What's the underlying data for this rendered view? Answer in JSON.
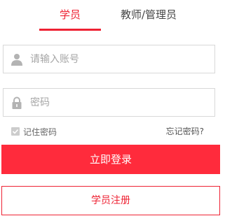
{
  "tabs": {
    "student": "学员",
    "teacher": "教师/管理员",
    "active": "student"
  },
  "account": {
    "icon": "user-icon",
    "placeholder": "请输入账号",
    "value": ""
  },
  "password": {
    "icon": "lock-icon",
    "placeholder": "密码",
    "value": ""
  },
  "remember": {
    "label": "记住密码",
    "checked": true
  },
  "forgot_label": "忘记密码?",
  "login_label": "立即登录",
  "register_label": "学员注册",
  "colors": {
    "accent": "#ee2233",
    "login_bg": "#ff2b3c",
    "border": "#d8d8d8",
    "placeholder": "#a6a6a6"
  }
}
